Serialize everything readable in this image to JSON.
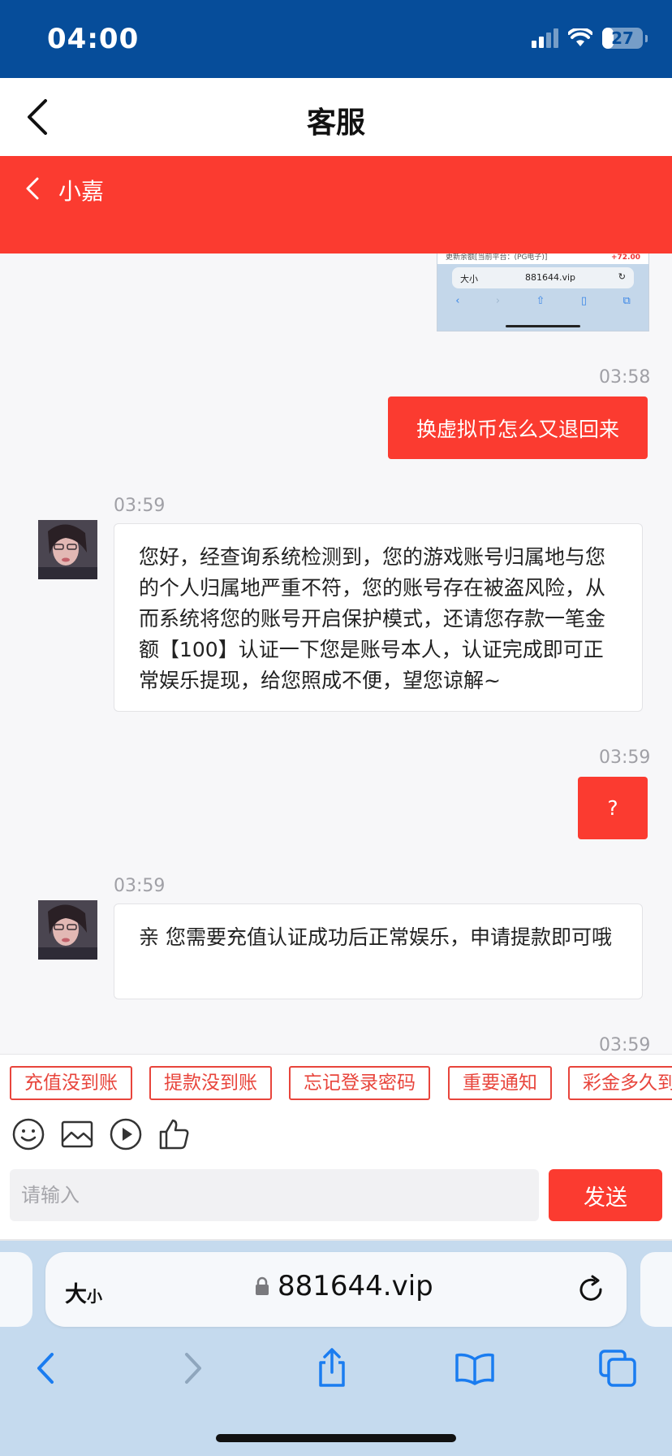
{
  "status_bar": {
    "time": "04:00",
    "battery": "27",
    "battery_level": 0.27
  },
  "nav": {
    "title": "客服"
  },
  "chat_header": {
    "agent_name": "小嘉"
  },
  "screenshot_thumb": {
    "top_text": "更新余额[当前平台：(PG电子)]",
    "amount": "+72.00",
    "aa": "大小",
    "url": "881644.vip"
  },
  "messages": [
    {
      "side": "right",
      "time": "03:58",
      "text": "换虚拟币怎么又退回来"
    },
    {
      "side": "left",
      "time": "03:59",
      "text": "您好，经查询系统检测到，您的游戏账号归属地与您的个人归属地严重不符，您的账号存在被盗风险，从而系统将您的账号开启保护模式，还请您存款一笔金额【100】认证一下您是账号本人，认证完成即可正常娱乐提现，给您照成不便，望您谅解~"
    },
    {
      "side": "right",
      "time": "03:59",
      "text": "?"
    },
    {
      "side": "left",
      "time": "03:59",
      "text": "亲 您需要充值认证成功后正常娱乐，申请提款即可哦"
    },
    {
      "side": "right",
      "time": "03:59",
      "text": ""
    }
  ],
  "quick_replies": [
    "充值没到账",
    "提款没到账",
    "忘记登录密码",
    "重要通知",
    "彩金多久到"
  ],
  "toolbar": {
    "icons": [
      "emoji-icon",
      "image-icon",
      "video-icon",
      "thumbs-up-icon"
    ]
  },
  "composer": {
    "placeholder": "请输入",
    "send_label": "发送"
  },
  "safari": {
    "aa_big": "大",
    "aa_small": "小",
    "url": "881644.vip"
  },
  "colors": {
    "status_bar": "#064d9a",
    "accent_red": "#fb3b30",
    "safari_bg": "#c5daee"
  }
}
